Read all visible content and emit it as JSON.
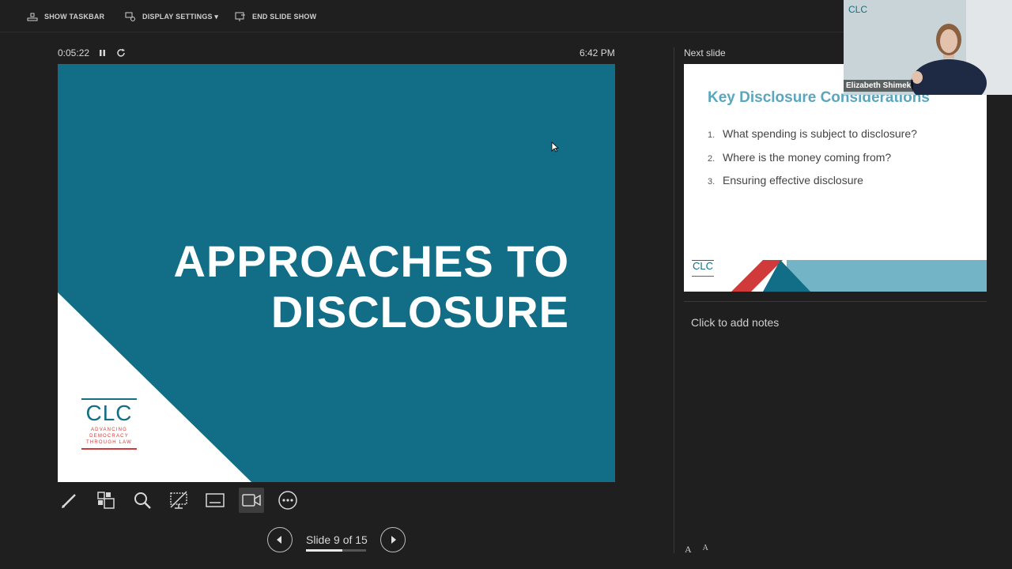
{
  "toolbar": {
    "show_taskbar": "SHOW TASKBAR",
    "display_settings": "DISPLAY SETTINGS ▾",
    "end_slide_show": "END SLIDE SHOW"
  },
  "presenter": {
    "elapsed_time": "0:05:22",
    "clock": "6:42 PM",
    "slide_counter": "Slide 9 of 15",
    "progress_fraction": 0.6
  },
  "current_slide": {
    "title_line1": "APPROACHES TO",
    "title_line2": "DISCLOSURE",
    "logo_main": "CLC",
    "logo_sub": [
      "ADVANCING",
      "DEMOCRACY",
      "THROUGH LAW"
    ],
    "background_color": "#126e86"
  },
  "next_slide": {
    "label": "Next slide",
    "title": "Key Disclosure Considerations",
    "items": [
      {
        "num": "1.",
        "text": "What spending is subject to disclosure?"
      },
      {
        "num": "2.",
        "text": "Where is the money coming from?"
      },
      {
        "num": "3.",
        "text": "Ensuring effective disclosure"
      }
    ],
    "logo_main": "CLC"
  },
  "notes": {
    "placeholder": "Click to add notes"
  },
  "webcam": {
    "name": "Elizabeth Shimek",
    "logo": "CLC"
  },
  "tools": [
    "pen-icon",
    "see-all-slides-icon",
    "zoom-icon",
    "black-screen-icon",
    "subtitles-icon",
    "camera-icon",
    "more-options-icon"
  ],
  "font_controls": {
    "increase": "A",
    "decrease": "A"
  }
}
